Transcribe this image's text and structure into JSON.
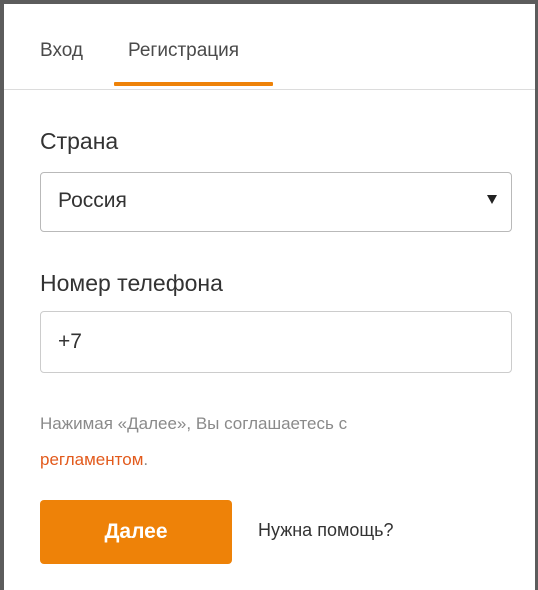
{
  "tabs": {
    "login_label": "Вход",
    "register_label": "Регистрация",
    "active": "register"
  },
  "form": {
    "country_label": "Страна",
    "country_value": "Россия",
    "phone_label": "Номер телефона",
    "phone_value": "+7",
    "agreement_text": "Нажимая «Далее», Вы соглашаетесь с ",
    "agreement_link": "регламентом",
    "agreement_end": ".",
    "next_button": "Далее",
    "help_link": "Нужна помощь?"
  },
  "colors": {
    "accent": "#ee8208",
    "link": "#e25a1c",
    "muted_text": "#8a8a8a"
  }
}
